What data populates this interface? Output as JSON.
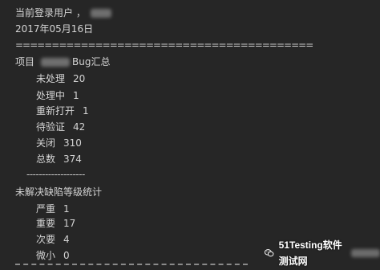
{
  "console": {
    "login_label": "当前登录用户 ，",
    "date": "2017年05月16日",
    "divider_top": "=========================================",
    "project_label": "项目",
    "project_suffix": "Bug汇总",
    "bug_summary": [
      {
        "label": "未处理",
        "value": "20"
      },
      {
        "label": "处理中",
        "value": "1"
      },
      {
        "label": "重新打开",
        "value": "1"
      },
      {
        "label": "待验证",
        "value": "42"
      },
      {
        "label": "关闭",
        "value": "310"
      },
      {
        "label": "总数",
        "value": "374"
      }
    ],
    "divider_mid": "-------------------",
    "severity_title": "未解决缺陷等级统计",
    "severity": [
      {
        "label": "严重",
        "value": "1"
      },
      {
        "label": "重要",
        "value": "17"
      },
      {
        "label": "次要",
        "value": "4"
      },
      {
        "label": "微小",
        "value": "0"
      }
    ]
  },
  "watermark": {
    "text": "51Testing软件测试网",
    "icon": "wechat-icon"
  }
}
